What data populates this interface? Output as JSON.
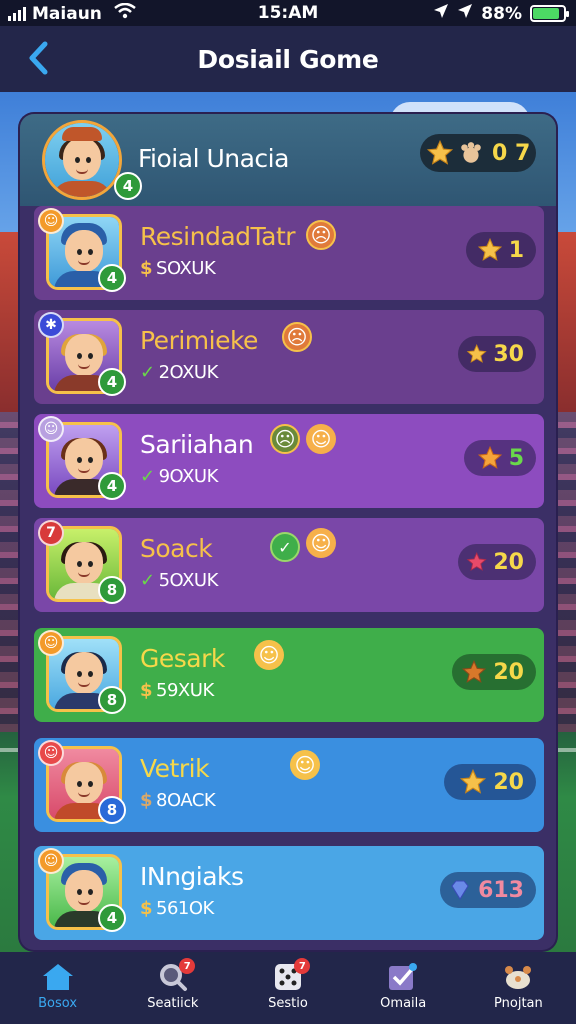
{
  "status_bar": {
    "carrier": "Maiaun",
    "time": "15:AM",
    "battery": "88%",
    "battery_level": 0.88,
    "icons": [
      "signal-icon",
      "wifi-icon",
      "location-icon",
      "location-icon",
      "battery-icon"
    ]
  },
  "header": {
    "title": "Dosiail Gome",
    "back_icon": "chevron-left-icon"
  },
  "current_player": {
    "name": "Fioial Unacia",
    "score": "0 7",
    "level": "4",
    "icons": [
      "star-icon",
      "pet-icon"
    ]
  },
  "rows": [
    {
      "name": "ResindadTatr",
      "sub": "SOXUK",
      "tag": "$",
      "score": "1",
      "level": "4",
      "bg": "#6a3f8e",
      "name_color": "#f6c14a"
    },
    {
      "name": "Perimieke",
      "sub": "2OXUK",
      "tag": "✓",
      "score": "30",
      "level": "4",
      "bg": "#6a3f8e",
      "name_color": "#f6c14a"
    },
    {
      "name": "Sariiahan",
      "sub": "9OXUK",
      "tag": "✓",
      "score": "5",
      "level": "4",
      "bg": "#8d4cbf",
      "name_color": "#ffffff"
    },
    {
      "name": "Soack",
      "sub": "5OXUK",
      "tag": "✓",
      "score": "20",
      "level": "8",
      "bg": "#7a47a8",
      "name_color": "#f6c14a"
    },
    {
      "name": "Gesark",
      "sub": "59XUK",
      "tag": "$",
      "score": "20",
      "level": "8",
      "bg": "#3fae4a",
      "name_color": "#f6d84a"
    },
    {
      "name": "Vetrik",
      "sub": "8OACK",
      "tag": "$",
      "score": "20",
      "level": "8",
      "bg": "#3a8fe0",
      "name_color": "#f6d84a"
    },
    {
      "name": "INngiaks",
      "sub": "561OK",
      "tag": "$",
      "score": "613",
      "level": "4",
      "bg": "#4aa6e6",
      "name_color": "#ffffff"
    }
  ],
  "nav": [
    {
      "label": "Bosox",
      "icon": "home-icon",
      "active": true,
      "badge": ""
    },
    {
      "label": "Seatiick",
      "icon": "search-icon",
      "active": false,
      "badge": "7"
    },
    {
      "label": "Sestio",
      "icon": "dice-icon",
      "active": false,
      "badge": "7"
    },
    {
      "label": "Omaila",
      "icon": "check-box-icon",
      "active": false,
      "badge": ""
    },
    {
      "label": "Pnojtan",
      "icon": "pet-icon",
      "active": false,
      "badge": ""
    }
  ]
}
